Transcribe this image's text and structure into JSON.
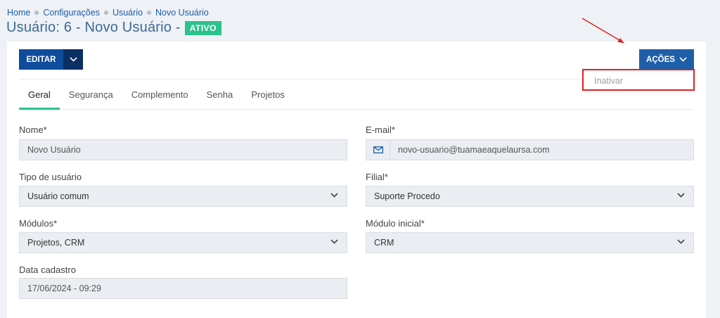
{
  "breadcrumb": {
    "items": [
      "Home",
      "Configurações",
      "Usuário",
      "Novo Usuário"
    ]
  },
  "header": {
    "title": "Usuário: 6 - Novo Usuário -",
    "status": "ATIVO",
    "status_color": "#2bc28b"
  },
  "toolbar": {
    "edit_label": "EDITAR",
    "actions_label": "AÇÕES"
  },
  "actions_menu": {
    "items": [
      "Inativar"
    ]
  },
  "tabs": [
    "Geral",
    "Segurança",
    "Complemento",
    "Senha",
    "Projetos"
  ],
  "form": {
    "nome": {
      "label": "Nome*",
      "value": "Novo Usuário"
    },
    "email": {
      "label": "E-mail*",
      "value": "novo-usuario@tuamaeaquelaursa.com"
    },
    "tipo_usuario": {
      "label": "Tipo de usuário",
      "value": "Usuário comum"
    },
    "filial": {
      "label": "Filial*",
      "value": "Suporte Procedo"
    },
    "modulos": {
      "label": "Módulos*",
      "value": "Projetos, CRM"
    },
    "modulo_inicial": {
      "label": "Módulo inicial*",
      "value": "CRM"
    },
    "data_cadastro": {
      "label": "Data cadastro",
      "value": "17/06/2024 - 09:29"
    }
  },
  "colors": {
    "primary": "#1f5fa8",
    "edit": "#0f4c9c",
    "accent": "#2bc28b",
    "highlight": "#e02020"
  }
}
